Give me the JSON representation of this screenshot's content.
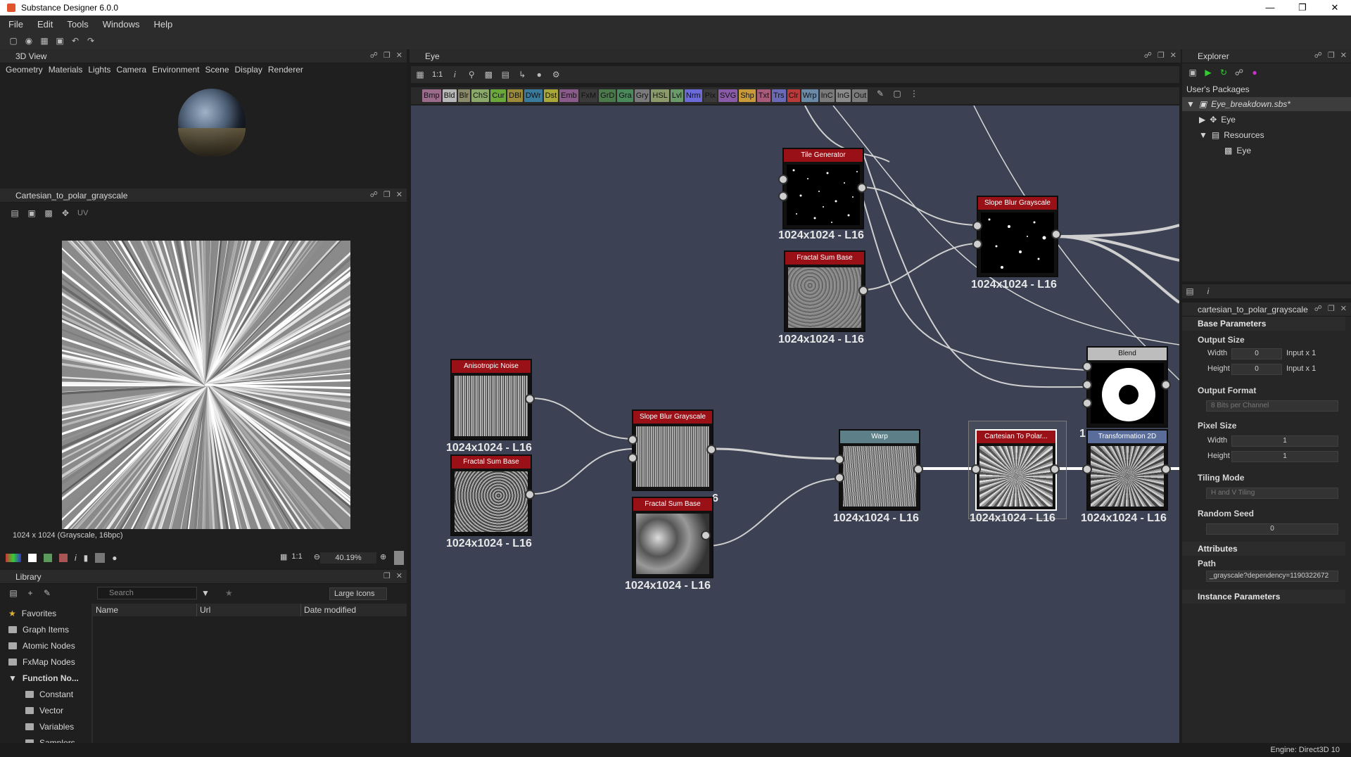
{
  "window": {
    "title": "Substance Designer 6.0.0"
  },
  "menu": [
    "File",
    "Edit",
    "Tools",
    "Windows",
    "Help"
  ],
  "view3d": {
    "title": "3D View",
    "tabs": [
      "Geometry",
      "Materials",
      "Lights",
      "Camera",
      "Environment",
      "Scene",
      "Display",
      "Renderer"
    ]
  },
  "view2d": {
    "title": "Cartesian_to_polar_grayscale",
    "channel_mode": "UV",
    "info": "1024 x 1024 (Grayscale, 16bpc)",
    "zoom_ratio": "1:1",
    "zoom": "40.19%"
  },
  "library": {
    "title": "Library",
    "search_placeholder": "Search",
    "view_mode": "Large Icons",
    "columns": [
      "Name",
      "Url",
      "Date modified"
    ],
    "items": [
      {
        "label": "Favorites"
      },
      {
        "label": "Graph Items"
      },
      {
        "label": "Atomic Nodes"
      },
      {
        "label": "FxMap Nodes"
      },
      {
        "label": "Function No..."
      },
      {
        "label": "Constant"
      },
      {
        "label": "Vector"
      },
      {
        "label": "Variables"
      },
      {
        "label": "Samplers"
      }
    ]
  },
  "graph": {
    "title": "Eye",
    "zoom_ratio": "1:1",
    "palette": [
      {
        "label": "Bmp",
        "color": "#9a6b8a"
      },
      {
        "label": "Bld",
        "color": "#b8b8b8"
      },
      {
        "label": "Blr",
        "color": "#8a8a6a"
      },
      {
        "label": "ChS",
        "color": "#8aa86a"
      },
      {
        "label": "Cur",
        "color": "#6aa83a"
      },
      {
        "label": "DBl",
        "color": "#9a8a3a"
      },
      {
        "label": "DWr",
        "color": "#3a7a9a"
      },
      {
        "label": "Dst",
        "color": "#a8a83a"
      },
      {
        "label": "Emb",
        "color": "#8a5a8a"
      },
      {
        "label": "FxM",
        "color": "#3a3a3a"
      },
      {
        "label": "GrD",
        "color": "#4a7a4a"
      },
      {
        "label": "Gra",
        "color": "#4a8a5a"
      },
      {
        "label": "Gry",
        "color": "#7a7a7a"
      },
      {
        "label": "HSL",
        "color": "#8a9a6a"
      },
      {
        "label": "Lvl",
        "color": "#6a9a6a"
      },
      {
        "label": "Nrm",
        "color": "#6a6ad8"
      },
      {
        "label": "Pix",
        "color": "#3a3a3a"
      },
      {
        "label": "SVG",
        "color": "#8a5aa8"
      },
      {
        "label": "Shp",
        "color": "#c89a3a"
      },
      {
        "label": "Txt",
        "color": "#a85a7a"
      },
      {
        "label": "Trs",
        "color": "#6a6ab8"
      },
      {
        "label": "Clr",
        "color": "#b83a3a"
      },
      {
        "label": "Wrp",
        "color": "#6a8aa8"
      },
      {
        "label": "InC",
        "color": "#7a7a7a"
      },
      {
        "label": "InG",
        "color": "#8a8a8a"
      },
      {
        "label": "Out",
        "color": "#7a7a7a"
      }
    ],
    "nodes": [
      {
        "title": "Tile Generator",
        "label": "1024x1024 - L16"
      },
      {
        "title": "Fractal Sum Base",
        "label": "1024x1024 - L16"
      },
      {
        "title": "Slope Blur Grayscale",
        "label": "1024x1024 - L16"
      },
      {
        "title": "Anisotropic Noise",
        "label": "1024x1024 - L16"
      },
      {
        "title": "Fractal Sum Base",
        "label": "1024x1024 - L16"
      },
      {
        "title": "Slope Blur Grayscale",
        "label": "6"
      },
      {
        "title": "Fractal Sum Base",
        "label": "1024x1024 - L16"
      },
      {
        "title": "Warp",
        "label": "1024x1024 - L16"
      },
      {
        "title": "Cartesian To Polar...",
        "label": "1024x1024 - L16"
      },
      {
        "title": "Blend",
        "label": "1 6"
      },
      {
        "title": "Transformation 2D",
        "label": "1024x1024 - L16"
      }
    ]
  },
  "explorer": {
    "title": "Explorer",
    "section": "User's Packages",
    "items": [
      "Eye_breakdown.sbs*",
      "Eye",
      "Resources",
      "Eye"
    ]
  },
  "params": {
    "title": "cartesian_to_polar_grayscale",
    "base_parameters": "Base Parameters",
    "output_size": "Output Size",
    "width": "Width",
    "height": "Height",
    "output_width_value": "0",
    "output_height_value": "0",
    "input_x1": "Input x 1",
    "output_format": "Output Format",
    "output_format_value": "8 Bits per Channel",
    "pixel_size": "Pixel Size",
    "pixel_width_value": "1",
    "pixel_height_value": "1",
    "tiling_mode": "Tiling Mode",
    "tiling_mode_value": "H and V Tiling",
    "random_seed": "Random Seed",
    "random_seed_value": "0",
    "attributes": "Attributes",
    "path_label": "Path",
    "path_value": "_grayscale?dependency=1190322672",
    "instance_parameters": "Instance Parameters"
  },
  "status": {
    "engine": "Engine: Direct3D 10"
  }
}
